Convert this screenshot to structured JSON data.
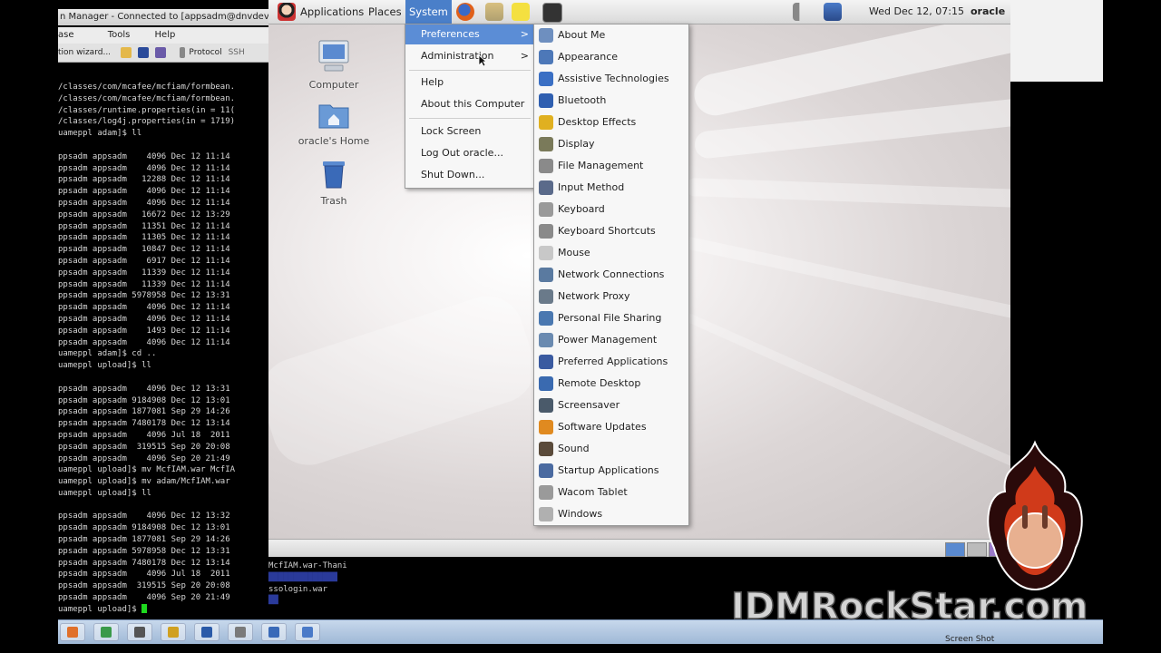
{
  "host": {
    "title": "n Manager - Connected to [appsadm@dnvdevoamapp",
    "menubar": [
      "ase",
      "Tools",
      "Help"
    ],
    "toolbar_text": "tion wizard...",
    "toolbar_protocol": "Protocol",
    "toolbar_protocol_value": "SSH"
  },
  "terminal": {
    "lines": [
      "/classes/com/mcafee/mcfiam/formbean.",
      "/classes/com/mcafee/mcfiam/formbean.",
      "/classes/runtime.properties(in = 11(",
      "/classes/log4j.properties(in = 1719)",
      "uameppl adam]$ ll",
      "",
      "ppsadm appsadm    4096 Dec 12 11:14",
      "ppsadm appsadm    4096 Dec 12 11:14",
      "ppsadm appsadm   12288 Dec 12 11:14",
      "ppsadm appsadm    4096 Dec 12 11:14",
      "ppsadm appsadm    4096 Dec 12 11:14",
      "ppsadm appsadm   16672 Dec 12 13:29",
      "ppsadm appsadm   11351 Dec 12 11:14",
      "ppsadm appsadm   11305 Dec 12 11:14",
      "ppsadm appsadm   10847 Dec 12 11:14",
      "ppsadm appsadm    6917 Dec 12 11:14",
      "ppsadm appsadm   11339 Dec 12 11:14",
      "ppsadm appsadm   11339 Dec 12 11:14",
      "ppsadm appsadm 5978958 Dec 12 13:31",
      "ppsadm appsadm    4096 Dec 12 11:14",
      "ppsadm appsadm    4096 Dec 12 11:14",
      "ppsadm appsadm    1493 Dec 12 11:14",
      "ppsadm appsadm    4096 Dec 12 11:14",
      "uameppl adam]$ cd ..",
      "uameppl upload]$ ll",
      "",
      "ppsadm appsadm    4096 Dec 12 13:31",
      "ppsadm appsadm 9184908 Dec 12 13:01",
      "ppsadm appsadm 1877081 Sep 29 14:26",
      "ppsadm appsadm 7480178 Dec 12 13:14",
      "ppsadm appsadm    4096 Jul 18  2011",
      "ppsadm appsadm  319515 Sep 20 20:08",
      "ppsadm appsadm    4096 Sep 20 21:49",
      "uameppl upload]$ mv McfIAM.war McfIA",
      "uameppl upload]$ mv adam/McfIAM.war",
      "uameppl upload]$ ll",
      "",
      "ppsadm appsadm    4096 Dec 12 13:32",
      "ppsadm appsadm 9184908 Dec 12 13:01",
      "ppsadm appsadm 1877081 Sep 29 14:26",
      "ppsadm appsadm 5978958 Dec 12 13:31",
      "ppsadm appsadm 7480178 Dec 12 13:14",
      "ppsadm appsadm    4096 Jul 18  2011",
      "ppsadm appsadm  319515 Sep 20 20:08",
      "ppsadm appsadm    4096 Sep 20 21:49",
      "uameppl upload]$ "
    ],
    "tail": [
      "McfIAM.war-Thani",
      "",
      "ssologin.war"
    ]
  },
  "panel": {
    "applications": "Applications",
    "places": "Places",
    "system": "System",
    "clock": "Wed Dec 12, 07:15",
    "user": "oracle"
  },
  "desktop_icons": [
    {
      "label": "Computer",
      "icon": "computer-icon"
    },
    {
      "label": "oracle's Home",
      "icon": "home-folder-icon"
    },
    {
      "label": "Trash",
      "icon": "trash-icon"
    }
  ],
  "system_menu": {
    "items": [
      {
        "label": "Preferences",
        "submenu": true
      },
      {
        "label": "Administration",
        "submenu": true
      },
      {
        "label": "Help"
      },
      {
        "label": "About this Computer"
      },
      {
        "label": "Lock Screen"
      },
      {
        "label": "Log Out oracle..."
      },
      {
        "label": "Shut Down..."
      }
    ],
    "arrow": ">"
  },
  "preferences_menu": {
    "items": [
      {
        "label": "About Me",
        "icon": "about-me-icon",
        "color": "#6e8fbf"
      },
      {
        "label": "Appearance",
        "icon": "appearance-icon",
        "color": "#4d78b8"
      },
      {
        "label": "Assistive Technologies",
        "icon": "accessibility-icon",
        "color": "#3a6fc4"
      },
      {
        "label": "Bluetooth",
        "icon": "bluetooth-icon",
        "color": "#2f5fb0"
      },
      {
        "label": "Desktop Effects",
        "icon": "desktop-effects-icon",
        "color": "#e0b020"
      },
      {
        "label": "Display",
        "icon": "display-icon",
        "color": "#7a7a5a"
      },
      {
        "label": "File Management",
        "icon": "file-management-icon",
        "color": "#8a8a8a"
      },
      {
        "label": "Input Method",
        "icon": "input-method-icon",
        "color": "#5a6a8a"
      },
      {
        "label": "Keyboard",
        "icon": "keyboard-icon",
        "color": "#9a9a9a"
      },
      {
        "label": "Keyboard Shortcuts",
        "icon": "keyboard-shortcuts-icon",
        "color": "#8a8a8a"
      },
      {
        "label": "Mouse",
        "icon": "mouse-icon",
        "color": "#c8c8c8"
      },
      {
        "label": "Network Connections",
        "icon": "network-connections-icon",
        "color": "#5a7aa0"
      },
      {
        "label": "Network Proxy",
        "icon": "network-proxy-icon",
        "color": "#6a7a8a"
      },
      {
        "label": "Personal File Sharing",
        "icon": "file-sharing-icon",
        "color": "#4a78b0"
      },
      {
        "label": "Power Management",
        "icon": "power-management-icon",
        "color": "#6a8ab0"
      },
      {
        "label": "Preferred Applications",
        "icon": "preferred-applications-icon",
        "color": "#3a5aa0"
      },
      {
        "label": "Remote Desktop",
        "icon": "remote-desktop-icon",
        "color": "#3a6ab0"
      },
      {
        "label": "Screensaver",
        "icon": "screensaver-icon",
        "color": "#4a5a6a"
      },
      {
        "label": "Software Updates",
        "icon": "software-updates-icon",
        "color": "#e08a20"
      },
      {
        "label": "Sound",
        "icon": "sound-icon",
        "color": "#5a4a3a"
      },
      {
        "label": "Startup Applications",
        "icon": "startup-applications-icon",
        "color": "#4a6aa0"
      },
      {
        "label": "Wacom Tablet",
        "icon": "wacom-tablet-icon",
        "color": "#9a9a9a"
      },
      {
        "label": "Windows",
        "icon": "windows-icon",
        "color": "#b0b0b0"
      }
    ]
  },
  "host_taskbar": {
    "apps": [
      {
        "icon": "firefox-taskbar-icon",
        "color": "#e0702a"
      },
      {
        "icon": "chrome-taskbar-icon",
        "color": "#3a9a4a"
      },
      {
        "icon": "vnc-taskbar-icon",
        "color": "#555555"
      },
      {
        "icon": "ie-taskbar-icon",
        "color": "#d0a020"
      },
      {
        "icon": "word-taskbar-icon",
        "color": "#2a5aa8"
      },
      {
        "icon": "putty-taskbar-icon",
        "color": "#7a7a7a"
      },
      {
        "icon": "explorer-taskbar-icon",
        "color": "#3a6ab8"
      },
      {
        "icon": "remote-taskbar-icon",
        "color": "#4a7ac8"
      }
    ],
    "thumb_label": "Screen Shot"
  },
  "brand": {
    "text": "IDMRockStar.com",
    "logo": "idmrockstar-logo"
  }
}
